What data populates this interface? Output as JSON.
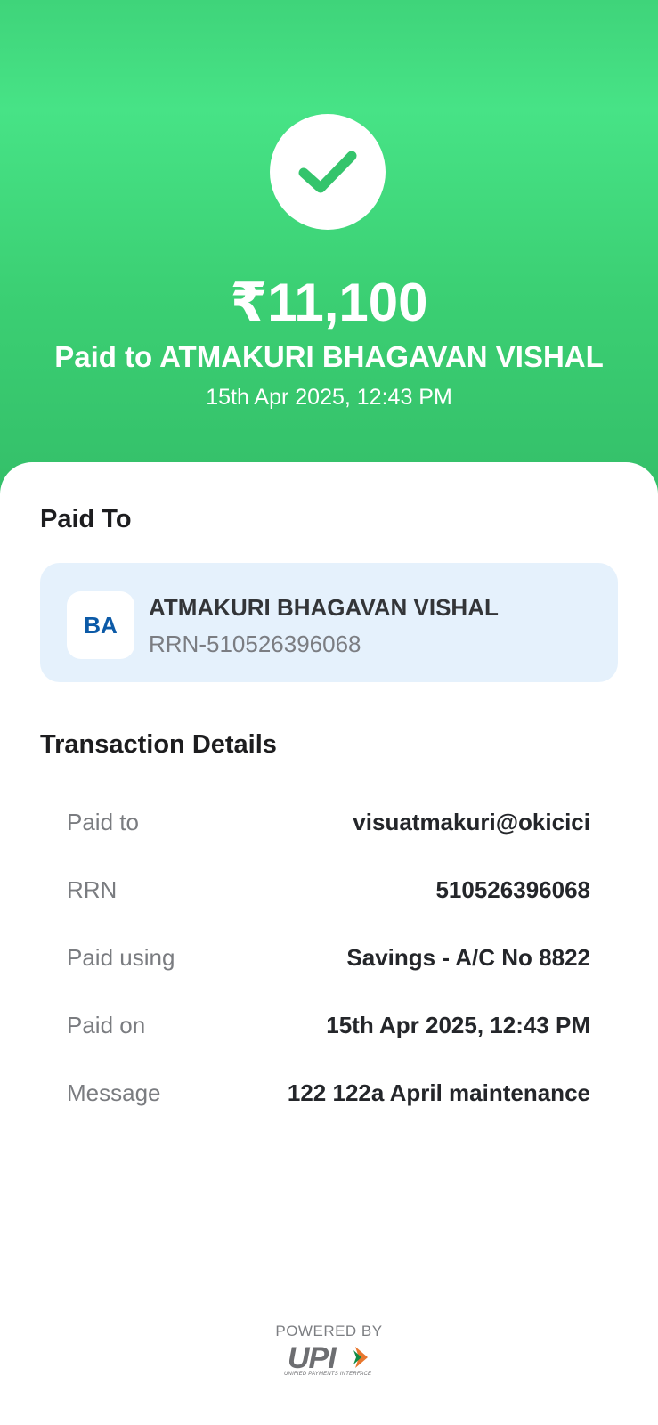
{
  "header": {
    "status_icon": "check-icon",
    "amount": "₹11,100",
    "paid_to_line": "Paid to ATMAKURI BHAGAVAN VISHAL",
    "datetime": "15th Apr 2025, 12:43 PM"
  },
  "paid_to_section": {
    "title": "Paid To",
    "avatar_initials": "BA",
    "name": "ATMAKURI BHAGAVAN VISHAL",
    "rrn": "RRN-510526396068"
  },
  "transaction_details": {
    "title": "Transaction Details",
    "rows": [
      {
        "label": "Paid to",
        "value": "visuatmakuri@okicici"
      },
      {
        "label": "RRN",
        "value": "510526396068"
      },
      {
        "label": "Paid using",
        "value": "Savings - A/C No 8822"
      },
      {
        "label": "Paid on",
        "value": "15th Apr 2025, 12:43 PM"
      },
      {
        "label": "Message",
        "value": "122 122a April maintenance"
      }
    ]
  },
  "footer": {
    "powered_by": "POWERED BY",
    "logo_text": "UPI",
    "logo_subtext": "UNIFIED PAYMENTS INTERFACE"
  },
  "colors": {
    "success_green": "#47e386",
    "card_blue": "#e5f1fc",
    "avatar_text": "#0c5aa7"
  }
}
